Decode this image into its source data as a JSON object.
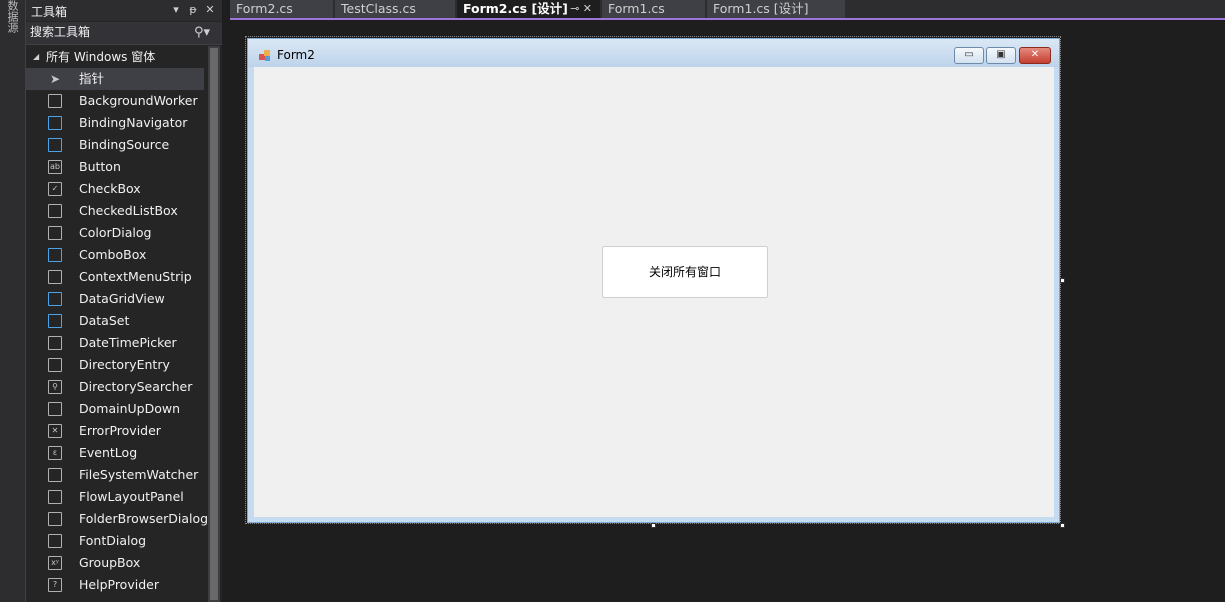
{
  "side_strip": {
    "label": "数据源"
  },
  "toolbox": {
    "title": "工具箱",
    "search_placeholder": "搜索工具箱",
    "group_label": "所有 Windows 窗体",
    "items": [
      {
        "label": "指针",
        "icon": "pointer-arrow-icon"
      },
      {
        "label": "BackgroundWorker",
        "icon": "background-worker-icon"
      },
      {
        "label": "BindingNavigator",
        "icon": "binding-navigator-icon"
      },
      {
        "label": "BindingSource",
        "icon": "binding-source-icon"
      },
      {
        "label": "Button",
        "icon": "button-ab-icon"
      },
      {
        "label": "CheckBox",
        "icon": "checkbox-icon"
      },
      {
        "label": "CheckedListBox",
        "icon": "checked-list-box-icon"
      },
      {
        "label": "ColorDialog",
        "icon": "color-dialog-icon"
      },
      {
        "label": "ComboBox",
        "icon": "combobox-icon"
      },
      {
        "label": "ContextMenuStrip",
        "icon": "context-menu-strip-icon"
      },
      {
        "label": "DataGridView",
        "icon": "data-grid-view-icon"
      },
      {
        "label": "DataSet",
        "icon": "dataset-icon"
      },
      {
        "label": "DateTimePicker",
        "icon": "date-time-picker-icon"
      },
      {
        "label": "DirectoryEntry",
        "icon": "directory-entry-icon"
      },
      {
        "label": "DirectorySearcher",
        "icon": "directory-searcher-icon"
      },
      {
        "label": "DomainUpDown",
        "icon": "domain-updown-icon"
      },
      {
        "label": "ErrorProvider",
        "icon": "error-provider-icon"
      },
      {
        "label": "EventLog",
        "icon": "event-log-icon"
      },
      {
        "label": "FileSystemWatcher",
        "icon": "file-system-watcher-icon"
      },
      {
        "label": "FlowLayoutPanel",
        "icon": "flow-layout-panel-icon"
      },
      {
        "label": "FolderBrowserDialog",
        "icon": "folder-browser-dialog-icon"
      },
      {
        "label": "FontDialog",
        "icon": "font-dialog-icon"
      },
      {
        "label": "GroupBox",
        "icon": "groupbox-icon"
      },
      {
        "label": "HelpProvider",
        "icon": "help-provider-icon"
      }
    ]
  },
  "tabs": [
    {
      "label": "Form2.cs",
      "active": false
    },
    {
      "label": "TestClass.cs",
      "active": false
    },
    {
      "label": "Form2.cs [设计]",
      "active": true
    },
    {
      "label": "Form1.cs",
      "active": false
    },
    {
      "label": "Form1.cs [设计]",
      "active": false
    }
  ],
  "form": {
    "title": "Form2",
    "button_label": "关闭所有窗口"
  },
  "colors": {
    "accent": "#9b75d9",
    "background": "#1e1e1e",
    "panel": "#252526"
  }
}
